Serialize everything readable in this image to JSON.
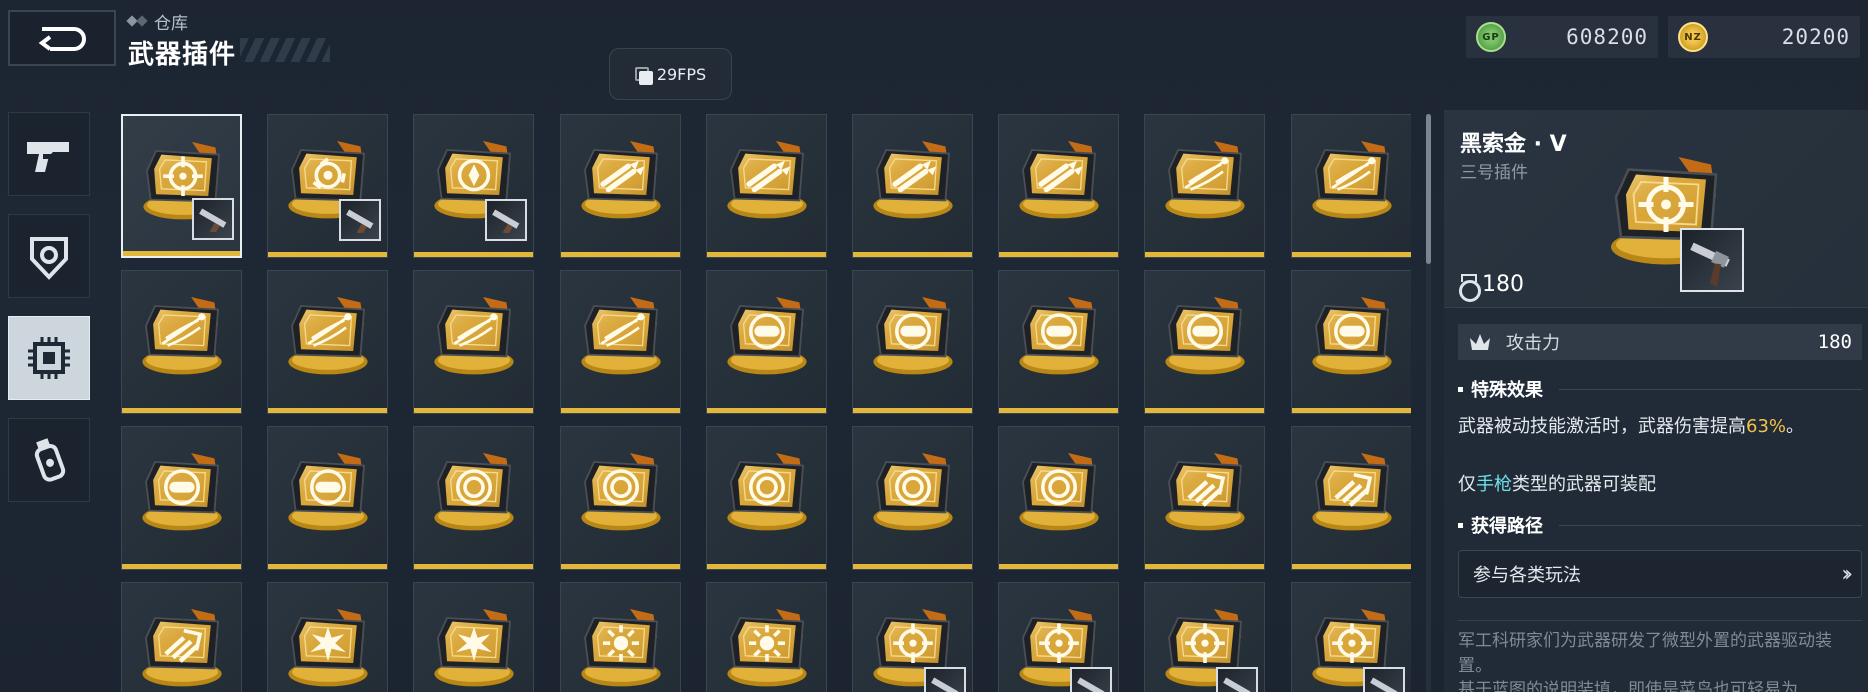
{
  "header": {
    "back_label": "",
    "breadcrumb": "仓库",
    "title": "武器插件",
    "fps": "29FPS"
  },
  "currencies": [
    {
      "icon": "gp-coin-icon",
      "label": "GP",
      "value": "608200",
      "color": "#5fae4b"
    },
    {
      "icon": "nz-coin-icon",
      "label": "NZ",
      "value": "20200",
      "color": "#e3b32e"
    }
  ],
  "categories": [
    {
      "icon": "pistol-icon",
      "active": false
    },
    {
      "icon": "shield-emblem-icon",
      "active": false
    },
    {
      "icon": "chip-icon",
      "active": true
    },
    {
      "icon": "grenade-icon",
      "active": false
    }
  ],
  "grid": {
    "rows": [
      [
        "target",
        "triad",
        "compass",
        "bullets",
        "bullets",
        "bullets",
        "bullets",
        "streak",
        "streak"
      ],
      [
        "streak",
        "streak",
        "streak",
        "streak",
        "capsule",
        "capsule",
        "capsule",
        "capsule",
        "capsule"
      ],
      [
        "capsule",
        "capsule",
        "rings",
        "rings",
        "rings",
        "rings",
        "rings",
        "arrows",
        "arrows"
      ],
      [
        "arrows",
        "burst",
        "burst",
        "star",
        "star",
        "target",
        "target",
        "target",
        "target"
      ]
    ],
    "weapon_thumbs": [
      [
        0,
        0
      ],
      [
        0,
        1
      ],
      [
        0,
        2
      ],
      [
        3,
        5
      ],
      [
        3,
        6
      ],
      [
        3,
        7
      ],
      [
        3,
        8
      ]
    ],
    "selected": [
      0,
      0
    ],
    "accent_color": "#e3b83a"
  },
  "detail": {
    "name": "黑索金 · V",
    "type": "三号插件",
    "power": "180",
    "stat_label": "攻击力",
    "stat_value": "180",
    "effect_title": "特殊效果",
    "effect_text_before": "武器被动技能激活时，武器伤害提高",
    "effect_highlight": "63%",
    "effect_text_after": "。",
    "restrict_before": "仅",
    "restrict_highlight": "手枪",
    "restrict_after": "类型的武器可装配",
    "source_title": "获得路径",
    "source_button": "参与各类玩法",
    "lore": "军工科研家们为武器研发了微型外置的武器驱动装置。",
    "lore_partial": "基于蓝图的说明装填，即使是菜鸟也可轻易为"
  }
}
